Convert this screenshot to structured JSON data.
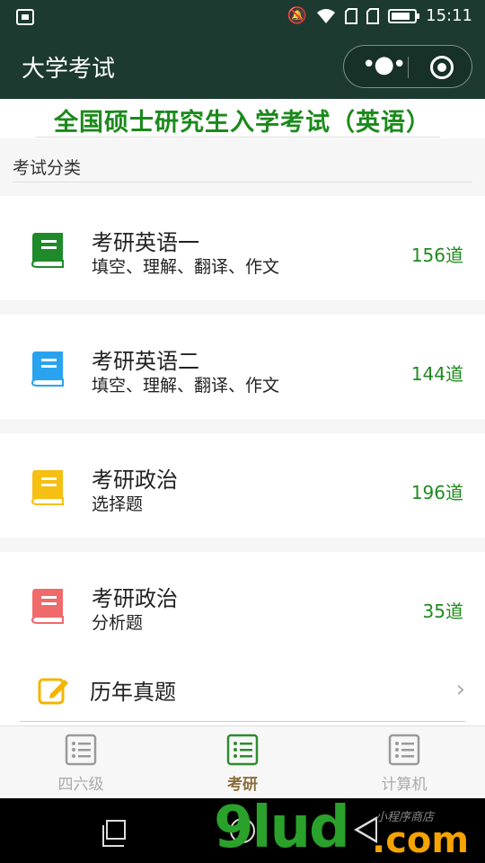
{
  "status_bar": {
    "time": "15:11",
    "icons": [
      "screenshot-icon",
      "bell-off-icon",
      "wifi-icon",
      "sim-icon",
      "sim-icon",
      "battery-icon"
    ]
  },
  "header": {
    "title": "大学考试",
    "more_icon": "more-dots-icon",
    "close_icon": "target-circle-icon",
    "color": "#1c3a2f"
  },
  "banner": {
    "text": "全国硕士研究生入学考试（英语）",
    "color": "#1b8a1b"
  },
  "section": {
    "label": "考试分类"
  },
  "exams": [
    {
      "name": "考研英语一",
      "desc": "填空、理解、翻译、作文",
      "count": "156道",
      "icon_color": "#1e8a2a",
      "icon": "book-icon"
    },
    {
      "name": "考研英语二",
      "desc": "填空、理解、翻译、作文",
      "count": "144道",
      "icon_color": "#29a3ef",
      "icon": "book-icon"
    },
    {
      "name": "考研政治",
      "desc": "选择题",
      "count": "196道",
      "icon_color": "#f7bf12",
      "icon": "book-icon"
    },
    {
      "name": "考研政治",
      "desc": "分析题",
      "count": "35道",
      "icon_color": "#ef6a6a",
      "icon": "book-icon"
    }
  ],
  "history": {
    "label": "历年真题",
    "icon": "edit-icon",
    "icon_color": "#f4b400"
  },
  "tabs": [
    {
      "label": "四六级",
      "icon": "list-icon",
      "active": false
    },
    {
      "label": "考研",
      "icon": "list-icon",
      "active": true
    },
    {
      "label": "计算机",
      "icon": "list-icon",
      "active": false
    }
  ],
  "watermark": {
    "big": "9lud",
    "com": ".com",
    "cn": "小程序商店"
  }
}
